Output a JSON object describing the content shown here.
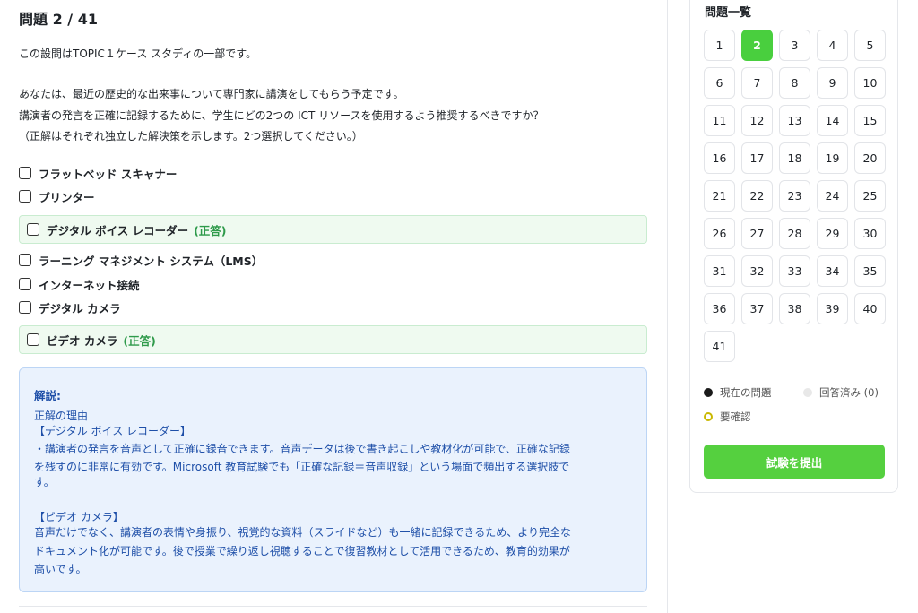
{
  "question": {
    "title": "問題 2 / 41",
    "lines": [
      "この設問はTOPIC１ケース スタディの一部です。",
      "あなたは、最近の歴史的な出来事について専門家に講演をしてもらう予定です。",
      "講演者の発言を正確に記録するために、学生にどの2つの ICT リソースを使用するよう推奨するべきですか？",
      "（正解はそれぞれ独立した解決策を示します。2つ選択してください。）"
    ]
  },
  "options": [
    {
      "label": "フラットベッド スキャナー",
      "correct": false
    },
    {
      "label": "プリンター",
      "correct": false
    },
    {
      "label": "デジタル ボイス レコーダー",
      "correct": true
    },
    {
      "label": "ラーニング マネジメント システム（LMS）",
      "correct": false
    },
    {
      "label": "インターネット接続",
      "correct": false
    },
    {
      "label": "デジタル カメラ",
      "correct": false
    },
    {
      "label": "ビデオ カメラ",
      "correct": true
    }
  ],
  "correct_tag": "(正答)",
  "explanation": {
    "title": "解説:",
    "lines": [
      "正解の理由",
      "【デジタル ボイス レコーダー】",
      "・講演者の発言を音声として正確に録音できます。音声データは後で書き起こしや教材化が可能で、正確な記録",
      "を残すのに非常に有効です。Microsoft 教育試験でも「正確な記録＝音声収録」という場面で頻出する選択肢で",
      "す。",
      "",
      "【ビデオ カメラ】",
      "音声だけでなく、講演者の表情や身振り、視覚的な資料（スライドなど）も一緒に記録できるため、より完全な",
      "ドキュメント化が可能です。後で授業で繰り返し視聴することで復習教材として活用できるため、教育的効果が",
      "高いです。"
    ]
  },
  "sidebar": {
    "title": "問題一覧",
    "numbers": [
      "1",
      "2",
      "3",
      "4",
      "5",
      "6",
      "7",
      "8",
      "9",
      "10",
      "11",
      "12",
      "13",
      "14",
      "15",
      "16",
      "17",
      "18",
      "19",
      "20",
      "21",
      "22",
      "23",
      "24",
      "25",
      "26",
      "27",
      "28",
      "29",
      "30",
      "31",
      "32",
      "33",
      "34",
      "35",
      "36",
      "37",
      "38",
      "39",
      "40",
      "41"
    ],
    "current": "2",
    "legend": {
      "current": "現在の問題",
      "answered": "回答済み (0)",
      "review": "要確認"
    },
    "submit_label": "試験を提出"
  },
  "colors": {
    "accent_green": "#49cf3e",
    "correct_bg": "#effaf0",
    "correct_text": "#2e9a4a",
    "explain_bg": "#eaf2fd",
    "explain_text": "#1e4fa8"
  }
}
